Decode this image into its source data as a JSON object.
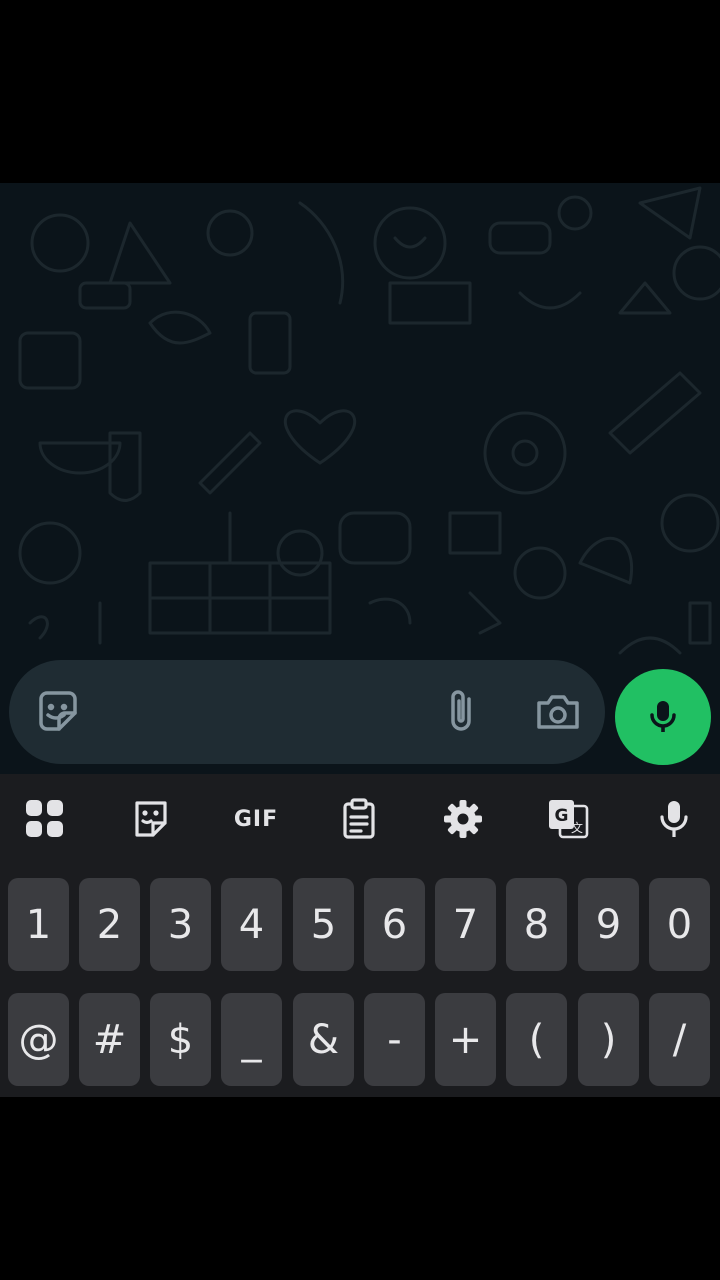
{
  "composer": {
    "emoji_icon": "sticker-smile-icon",
    "attach_icon": "paperclip-icon",
    "camera_icon": "camera-icon",
    "mic_icon": "microphone-icon",
    "accent": "#21c063"
  },
  "keyboard": {
    "toolbar": {
      "apps_icon": "apps-grid-icon",
      "sticker_icon": "sticker-icon",
      "gif_label": "GIF",
      "clipboard_icon": "clipboard-icon",
      "settings_icon": "gear-icon",
      "translate_icon": "translate-icon",
      "voice_icon": "microphone-icon"
    },
    "number_row": [
      "1",
      "2",
      "3",
      "4",
      "5",
      "6",
      "7",
      "8",
      "9",
      "0"
    ],
    "symbol_row": [
      "@",
      "#",
      "$",
      "_",
      "&",
      "-",
      "+",
      "(",
      ")",
      "/"
    ]
  }
}
